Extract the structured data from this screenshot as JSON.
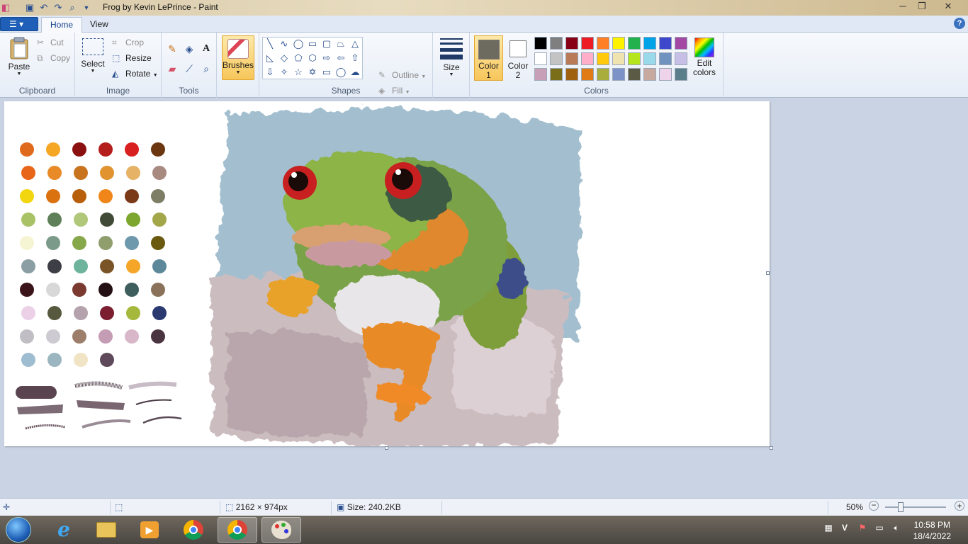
{
  "window": {
    "title": "Frog by Kevin LePrince - Paint",
    "controls": [
      "minimize",
      "maximize",
      "close"
    ]
  },
  "quick_access": [
    "save-icon",
    "undo-icon",
    "redo-icon",
    "zoom-icon",
    "customize-icon"
  ],
  "ribbon": {
    "tabs": [
      "Home",
      "View"
    ],
    "active_tab": "Home",
    "clipboard": {
      "paste": "Paste",
      "cut": "Cut",
      "copy": "Copy",
      "label": "Clipboard"
    },
    "image": {
      "select": "Select",
      "crop": "Crop",
      "resize": "Resize",
      "rotate": "Rotate",
      "label": "Image"
    },
    "tools": {
      "label": "Tools",
      "items": [
        "pencil-icon",
        "fill-icon",
        "text-icon",
        "eraser-icon",
        "color-picker-icon",
        "magnifier-icon"
      ]
    },
    "brushes": {
      "label": "Brushes"
    },
    "shapes": {
      "outline": "Outline",
      "fill": "Fill",
      "label": "Shapes"
    },
    "size": {
      "label": "Size"
    },
    "colors": {
      "color1_label": "Color",
      "color1_num": "1",
      "color1_value": "#6d6a5f",
      "color2_label": "Color",
      "color2_num": "2",
      "color2_value": "#ffffff",
      "edit": "Edit colors",
      "label": "Colors",
      "palette": [
        "#000000",
        "#7f7f7f",
        "#880015",
        "#ed1c24",
        "#ff7f27",
        "#fff200",
        "#22b14c",
        "#00a2e8",
        "#3f48cc",
        "#a349a4",
        "#ffffff",
        "#c3c3c3",
        "#b97a57",
        "#ffaec9",
        "#ffc90e",
        "#efe4b0",
        "#b5e61d",
        "#99d9ea",
        "#7092be",
        "#c8bfe7",
        "#c7a0b8",
        "#7a6f18",
        "#a0610e",
        "#e07b15",
        "#a8ad3b",
        "#7d93c8",
        "#5a5a45",
        "#c8a9a0",
        "#efd3eb",
        "#5a7f8a"
      ]
    }
  },
  "canvas": {
    "palette_dots": [
      "#e06a1c",
      "#f5a623",
      "#8b1010",
      "#b51c1c",
      "#d92020",
      "#6b3610",
      "#e8661a",
      "#e88a28",
      "#c8741f",
      "#e0932e",
      "#e6b266",
      "#a88a80",
      "#f2d60f",
      "#d9720f",
      "#b85f0c",
      "#f0861a",
      "#7a3a18",
      "#7e7e66",
      "#a9c266",
      "#5e8058",
      "#b1c779",
      "#404a36",
      "#7da62e",
      "#a4a64a",
      "#f5f5d4",
      "#7c9a8a",
      "#87a84a",
      "#8f9e6c",
      "#6e99ad",
      "#6a5a10",
      "#8a9ea4",
      "#3e3e46",
      "#6eb39c",
      "#7a5426",
      "#f5a628",
      "#5c8899",
      "#3a1418",
      "#d8d8d8",
      "#7a3a30",
      "#241014",
      "#3e5e5e",
      "#8a725a",
      "#ecd0e8",
      "#56593e",
      "#b4a2ac",
      "#7a1e30",
      "#a6b83c",
      "#2a3a70",
      "#c0bec4",
      "#cdcad2",
      "#9c7e6a",
      "#c49cb4",
      "#d8b8c8",
      "#4a3440",
      "#9ebdd0",
      "#9bb6c0",
      "#f0e4c4",
      "#5e4a5a"
    ]
  },
  "status": {
    "dimensions": "2162 × 974px",
    "size": "Size: 240.2KB",
    "zoom": "50%"
  },
  "taskbar": {
    "apps": [
      "start-button",
      "internet-explorer-icon",
      "file-explorer-icon",
      "media-player-icon",
      "chrome-icon",
      "chrome-icon",
      "paint-icon"
    ],
    "time": "10:58 PM",
    "date": "18/4/2022"
  }
}
